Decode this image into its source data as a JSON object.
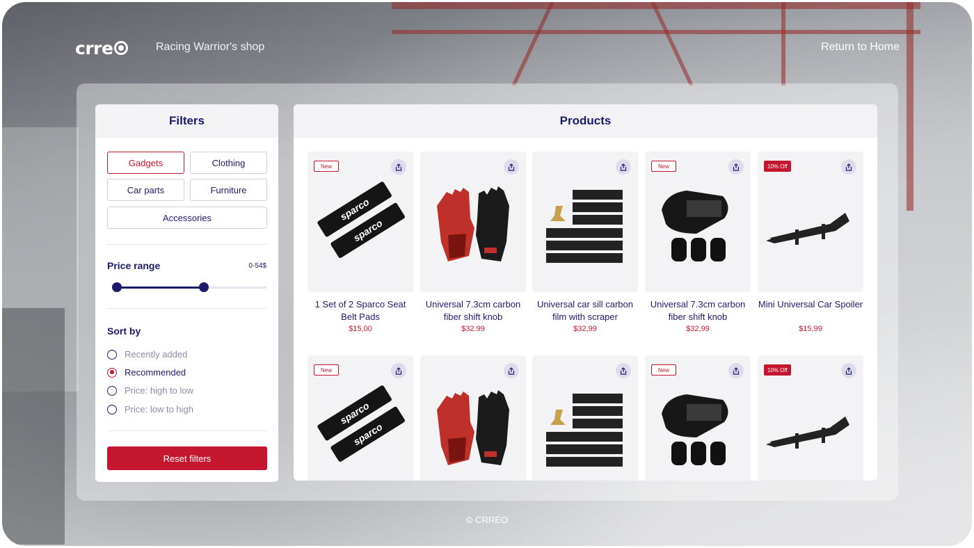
{
  "header": {
    "logo_text": "crre",
    "shop_title": "Racing Warrior's shop",
    "return_link": "Return to Home"
  },
  "filters": {
    "title": "Filters",
    "categories": [
      {
        "label": "Gadgets",
        "active": true
      },
      {
        "label": "Clothing",
        "active": false
      },
      {
        "label": "Car parts",
        "active": false
      },
      {
        "label": "Furniture",
        "active": false
      },
      {
        "label": "Accessories",
        "active": false
      }
    ],
    "price_range_label": "Price range",
    "price_range_value": "0-54$",
    "price_slider": {
      "low_fraction": 0.0,
      "high_fraction": 0.6
    },
    "sort_label": "Sort by",
    "sort_options": [
      {
        "label": "Recently added",
        "checked": false
      },
      {
        "label": "Recommended",
        "checked": true
      },
      {
        "label": "Price: high to low",
        "checked": false
      },
      {
        "label": "Price: low to high",
        "checked": false
      }
    ],
    "reset_label": "Reset filters"
  },
  "products": {
    "title": "Products",
    "items": [
      {
        "name": "1 Set of 2 Sparco Seat Belt Pads",
        "price": "$15,00",
        "badge": "New",
        "image": "seat-belt-pads"
      },
      {
        "name": "Universal 7.3cm carbon fiber shift knob",
        "price": "$32.99",
        "badge": "",
        "image": "racing-gloves"
      },
      {
        "name": "Universal car sill carbon film with scraper",
        "price": "$32,99",
        "badge": "",
        "image": "carbon-film"
      },
      {
        "name": "Universal 7.3cm carbon fiber shift knob",
        "price": "$32,99",
        "badge": "New",
        "image": "shift-knob"
      },
      {
        "name": "Mini Universal Car Spoiler",
        "price": "$15,99",
        "badge": "10% Off",
        "image": "spoiler"
      },
      {
        "name": "",
        "price": "",
        "badge": "New",
        "image": "seat-belt-pads"
      },
      {
        "name": "",
        "price": "",
        "badge": "",
        "image": "racing-gloves"
      },
      {
        "name": "",
        "price": "",
        "badge": "",
        "image": "carbon-film"
      },
      {
        "name": "",
        "price": "",
        "badge": "New",
        "image": "shift-knob"
      },
      {
        "name": "",
        "price": "",
        "badge": "10% Off",
        "image": "spoiler"
      }
    ]
  },
  "footer": {
    "copyright": "© CRREO"
  },
  "colors": {
    "accent": "#c4162f",
    "primary": "#1c1a6b"
  }
}
